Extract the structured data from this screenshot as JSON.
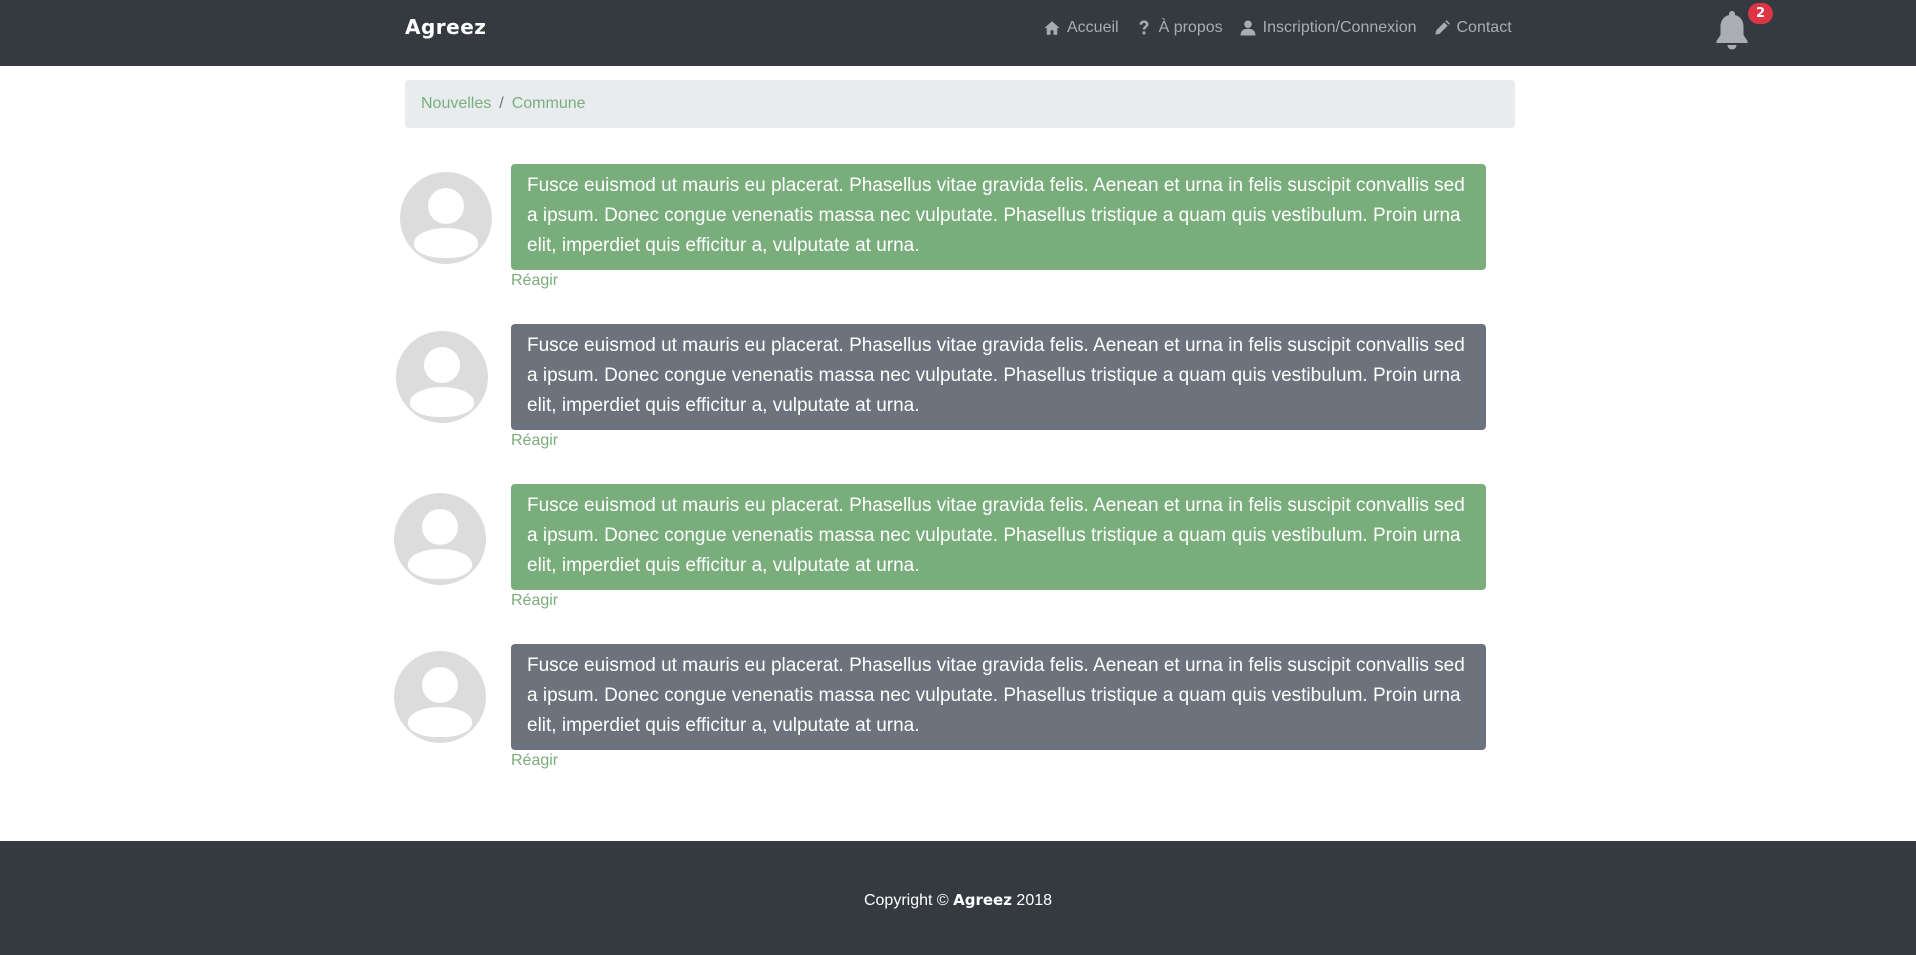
{
  "header": {
    "brand": "Agreez",
    "nav": [
      {
        "label": "Accueil",
        "icon": "home-icon"
      },
      {
        "label": "À propos",
        "icon": "question-icon"
      },
      {
        "label": "Inscription/Connexion",
        "icon": "user-icon"
      },
      {
        "label": "Contact",
        "icon": "pen-icon"
      }
    ],
    "notifications": {
      "icon": "bell-icon",
      "count": "2"
    }
  },
  "breadcrumb": {
    "items": [
      "Nouvelles",
      "Commune"
    ],
    "separator": "/"
  },
  "messages": [
    {
      "text": "Fusce euismod ut mauris eu placerat. Phasellus vitae gravida felis. Aenean et urna in felis suscipit convallis sed a ipsum. Donec congue venenatis massa nec vulputate. Phasellus tristique a quam quis vestibulum. Proin urna elit, imperdiet quis efficitur a, vulputate at urna.",
      "style": "green",
      "action": "Réagir"
    },
    {
      "text": "Fusce euismod ut mauris eu placerat. Phasellus vitae gravida felis. Aenean et urna in felis suscipit convallis sed a ipsum. Donec congue venenatis massa nec vulputate. Phasellus tristique a quam quis vestibulum. Proin urna elit, imperdiet quis efficitur a, vulputate at urna.",
      "style": "gray",
      "action": "Réagir"
    },
    {
      "text": "Fusce euismod ut mauris eu placerat. Phasellus vitae gravida felis. Aenean et urna in felis suscipit convallis sed a ipsum. Donec congue venenatis massa nec vulputate. Phasellus tristique a quam quis vestibulum. Proin urna elit, imperdiet quis efficitur a, vulputate at urna.",
      "style": "green",
      "action": "Réagir"
    },
    {
      "text": "Fusce euismod ut mauris eu placerat. Phasellus vitae gravida felis. Aenean et urna in felis suscipit convallis sed a ipsum. Donec congue venenatis massa nec vulputate. Phasellus tristique a quam quis vestibulum. Proin urna elit, imperdiet quis efficitur a, vulputate at urna.",
      "style": "gray",
      "action": "Réagir"
    }
  ],
  "footer": {
    "prefix": "Copyright ©",
    "brand": "Agreez",
    "year": "2018"
  },
  "colors": {
    "navbar": "#343a40",
    "accent_green": "#79ae7c",
    "bubble_gray": "#6c737d",
    "badge_red": "#dc3545",
    "breadcrumb_bg": "#e9ecef"
  }
}
